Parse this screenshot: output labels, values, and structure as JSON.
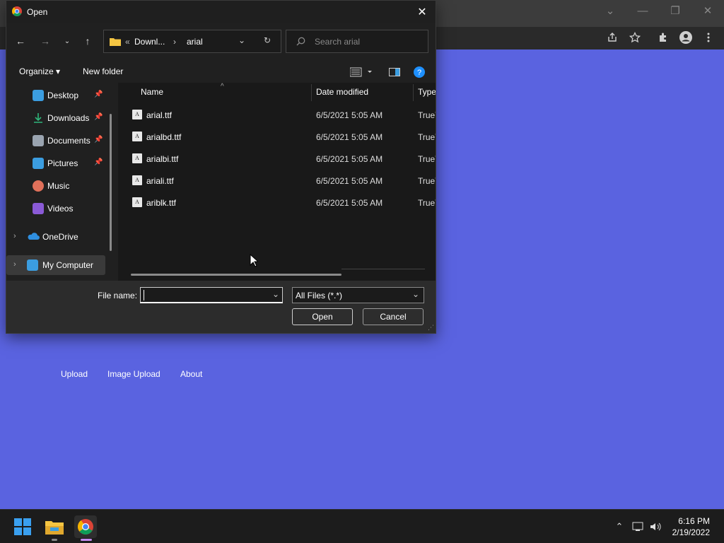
{
  "dialog": {
    "title": "Open",
    "address": {
      "prefix": "«",
      "crumb_parent": "Downl...",
      "crumb_current": "arial"
    },
    "search_placeholder": "Search arial",
    "commands": {
      "organize": "Organize",
      "new_folder": "New folder"
    },
    "nav_items": [
      {
        "label": "Desktop",
        "pinned": true,
        "color": "#3b9de0"
      },
      {
        "label": "Downloads",
        "pinned": true,
        "color": "#2fb67a"
      },
      {
        "label": "Documents",
        "pinned": true,
        "color": "#9aa4b0"
      },
      {
        "label": "Pictures",
        "pinned": true,
        "color": "#3b9de0"
      },
      {
        "label": "Music",
        "pinned": false,
        "color": "#e0705a"
      },
      {
        "label": "Videos",
        "pinned": false,
        "color": "#8a5ad6"
      },
      {
        "label": "OneDrive",
        "pinned": false,
        "color": "#2f8fe0"
      },
      {
        "label": "My Computer",
        "pinned": false,
        "color": "#3b9de0"
      }
    ],
    "columns": {
      "name": "Name",
      "date": "Date modified",
      "type": "Type"
    },
    "files": [
      {
        "name": "arial.ttf",
        "date": "6/5/2021 5:05 AM",
        "type": "TrueType"
      },
      {
        "name": "arialbd.ttf",
        "date": "6/5/2021 5:05 AM",
        "type": "TrueType"
      },
      {
        "name": "arialbi.ttf",
        "date": "6/5/2021 5:05 AM",
        "type": "TrueType"
      },
      {
        "name": "ariali.ttf",
        "date": "6/5/2021 5:05 AM",
        "type": "TrueType"
      },
      {
        "name": "ariblk.ttf",
        "date": "6/5/2021 5:05 AM",
        "type": "TrueType"
      }
    ],
    "file_name_label": "File name:",
    "file_name_value": "",
    "filter_value": "All Files (*.*)",
    "open_label": "Open",
    "cancel_label": "Cancel"
  },
  "page": {
    "nav": [
      "Upload",
      "Image Upload",
      "About"
    ]
  },
  "taskbar": {
    "time": "6:16 PM",
    "date": "2/19/2022"
  },
  "colors": {
    "page_bg": "#5a63e0",
    "dialog_bg": "#202020",
    "accent": "#1e90ff"
  }
}
